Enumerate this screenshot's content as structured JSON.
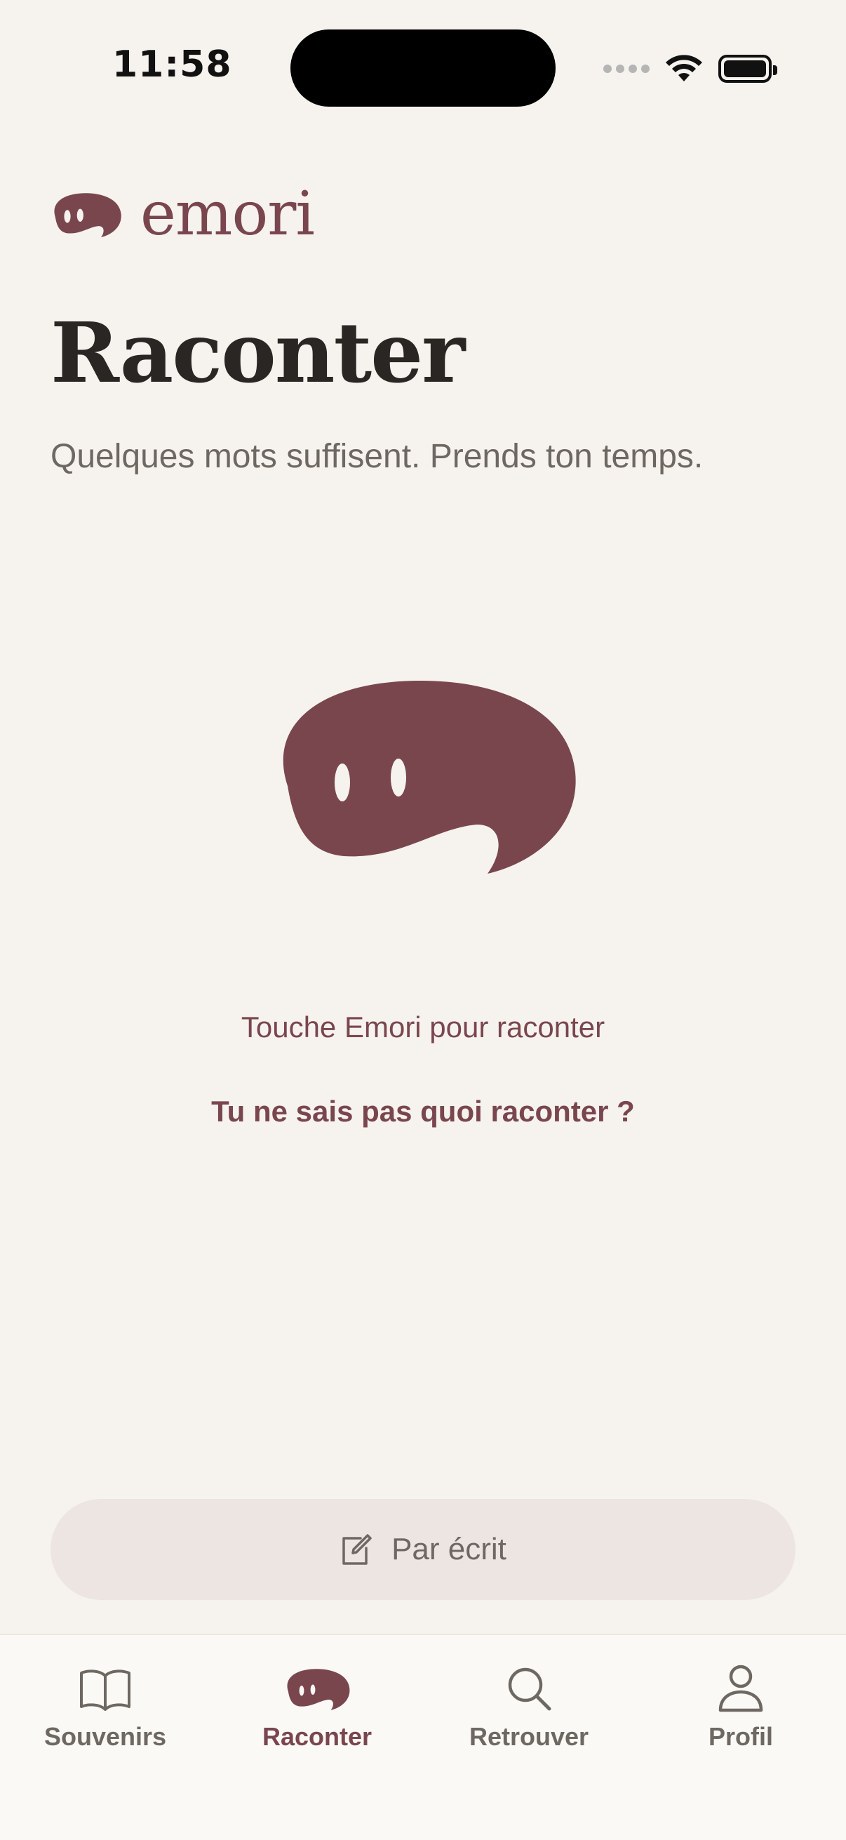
{
  "status_bar": {
    "time": "11:58"
  },
  "header": {
    "logo_text": "emori",
    "title": "Raconter",
    "subtitle": "Quelques mots suffisent. Prends ton temps."
  },
  "main": {
    "tap_hint": "Touche Emori pour raconter",
    "prompt_link": "Tu ne sais pas quoi raconter ?"
  },
  "write_button": {
    "label": "Par écrit"
  },
  "tab_bar": {
    "tabs": [
      {
        "label": "Souvenirs",
        "icon": "book-icon",
        "active": false
      },
      {
        "label": "Raconter",
        "icon": "emori-bubble-icon",
        "active": true
      },
      {
        "label": "Retrouver",
        "icon": "search-icon",
        "active": false
      },
      {
        "label": "Profil",
        "icon": "person-icon",
        "active": false
      }
    ]
  },
  "colors": {
    "background": "#F6F3EE",
    "accent": "#7A464E",
    "text_primary": "#2A2624",
    "text_secondary": "#6E6862",
    "write_button_bg": "#EDE5E2",
    "tab_bar_bg": "#FBF9F5"
  }
}
